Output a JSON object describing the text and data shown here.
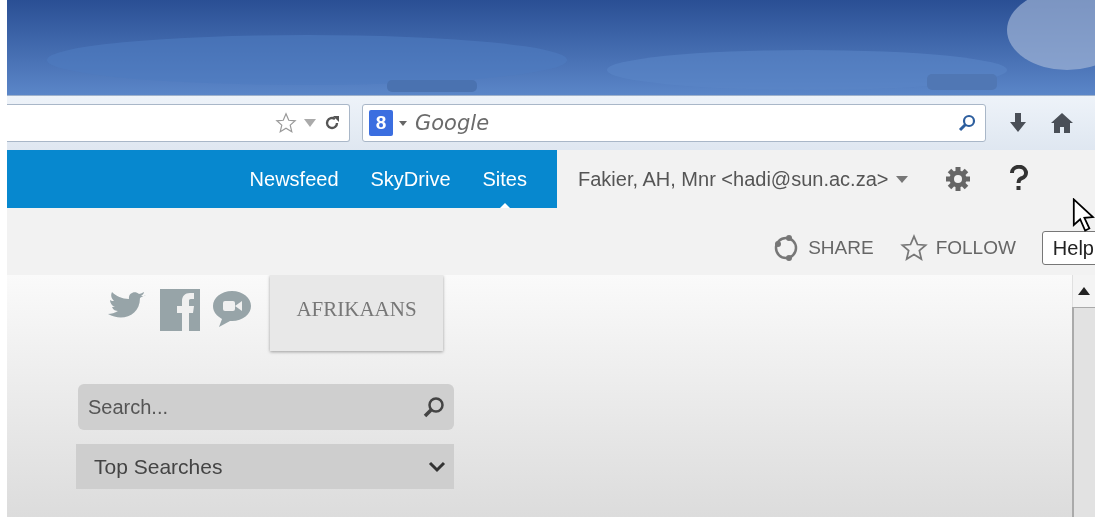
{
  "browser": {
    "search": {
      "engine_letter": "8",
      "placeholder": "Google"
    }
  },
  "nav": {
    "items": [
      {
        "label": "Newsfeed",
        "selected": false
      },
      {
        "label": "SkyDrive",
        "selected": false
      },
      {
        "label": "Sites",
        "selected": true
      }
    ],
    "user": "Fakier, AH, Mnr <hadi@sun.ac.za>"
  },
  "actions": [
    {
      "label": "SHARE",
      "kind": "share"
    },
    {
      "label": "FOLLOW",
      "kind": "follow"
    }
  ],
  "tooltip": "Help",
  "site": {
    "language_button": "AFRIKAANS",
    "search": {
      "placeholder": "Search..."
    },
    "top_searches": "Top Searches"
  }
}
